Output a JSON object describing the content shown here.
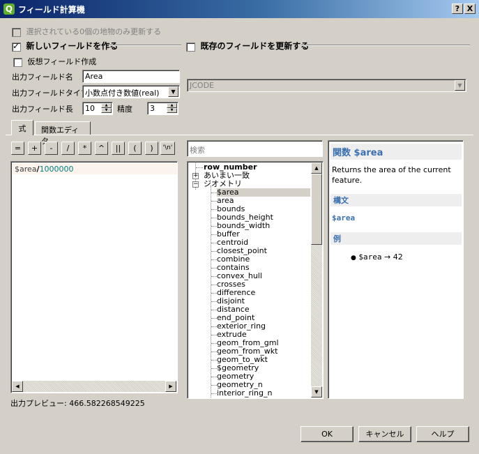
{
  "window": {
    "title": "フィールド計算機",
    "app_icon_letter": "Q",
    "help_btn": "?",
    "close_btn": "X"
  },
  "options": {
    "selected_only_label": "選択されている0個の地物のみ更新する",
    "new_field_label": "新しいフィールドを作る",
    "update_existing_label": "既存のフィールドを更新する",
    "virtual_field_label": "仮想フィールド作成"
  },
  "new_field": {
    "name_label": "出力フィールド名",
    "name_value": "Area",
    "type_label": "出力フィールドタイプ",
    "type_value": "小数点付き数値(real)",
    "length_label": "出力フィールド長",
    "length_value": "10",
    "precision_label": "精度",
    "precision_value": "3"
  },
  "existing_field": {
    "selected": "JCODE"
  },
  "tabs": [
    {
      "label": "式"
    },
    {
      "label": "関数エディタ"
    }
  ],
  "operators": [
    "=",
    "+",
    "-",
    "/",
    "*",
    "^",
    "||",
    "(",
    ")",
    "'\\n'"
  ],
  "expression": {
    "variable": "$area",
    "operator": "/",
    "number": "1000000"
  },
  "preview": {
    "label": "出力プレビュー:",
    "value": "466.582268549225"
  },
  "search": {
    "placeholder": "検索"
  },
  "tree": {
    "items": [
      {
        "label": "row_number",
        "bold": true
      },
      {
        "label": "あいまい一致",
        "group": true
      },
      {
        "label": "ジオメトリ",
        "group": true,
        "expanded": true
      },
      {
        "label": "$area",
        "selected": true
      },
      {
        "label": "area"
      },
      {
        "label": "bounds"
      },
      {
        "label": "bounds_height"
      },
      {
        "label": "bounds_width"
      },
      {
        "label": "buffer"
      },
      {
        "label": "centroid"
      },
      {
        "label": "closest_point"
      },
      {
        "label": "combine"
      },
      {
        "label": "contains"
      },
      {
        "label": "convex_hull"
      },
      {
        "label": "crosses"
      },
      {
        "label": "difference"
      },
      {
        "label": "disjoint"
      },
      {
        "label": "distance"
      },
      {
        "label": "end_point"
      },
      {
        "label": "exterior_ring"
      },
      {
        "label": "extrude"
      },
      {
        "label": "geom_from_gml"
      },
      {
        "label": "geom_from_wkt"
      },
      {
        "label": "geom_to_wkt"
      },
      {
        "label": "$geometry"
      },
      {
        "label": "geometry"
      },
      {
        "label": "geometry_n"
      },
      {
        "label": "interior_ring_n"
      }
    ]
  },
  "help": {
    "title": "関数 $area",
    "description": "Returns the area of the current feature.",
    "syntax_header": "構文",
    "syntax": "$area",
    "example_header": "例",
    "example_code": "$area",
    "example_arrow": "→",
    "example_result": "42"
  },
  "buttons": {
    "ok": "OK",
    "cancel": "キャンセル",
    "help": "ヘルプ"
  }
}
